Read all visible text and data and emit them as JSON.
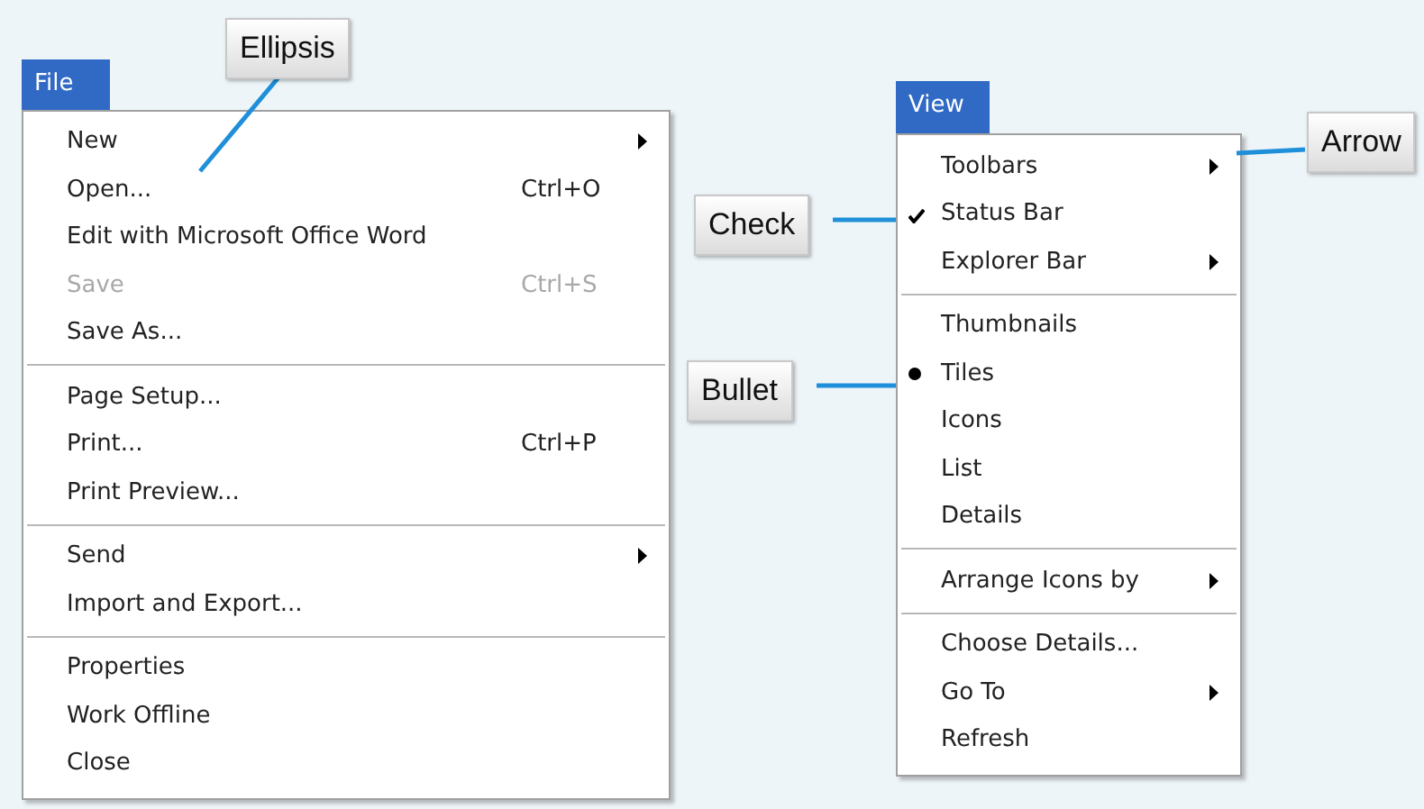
{
  "menus": [
    {
      "title": "File",
      "groups": [
        [
          {
            "label": "New",
            "submenu": true,
            "disabled": false
          },
          {
            "label": "Open...",
            "shortcut": "Ctrl+O",
            "submenu": false,
            "disabled": false
          },
          {
            "label": "Edit with Microsoft Office Word",
            "submenu": false,
            "disabled": false
          },
          {
            "label": "Save",
            "shortcut": "Ctrl+S",
            "submenu": false,
            "disabled": true
          },
          {
            "label": "Save As...",
            "submenu": false,
            "disabled": false
          }
        ],
        [
          {
            "label": "Page Setup...",
            "submenu": false,
            "disabled": false
          },
          {
            "label": "Print...",
            "shortcut": "Ctrl+P",
            "submenu": false,
            "disabled": false
          },
          {
            "label": "Print Preview...",
            "submenu": false,
            "disabled": false
          }
        ],
        [
          {
            "label": "Send",
            "submenu": true,
            "disabled": false
          },
          {
            "label": "Import and Export...",
            "submenu": false,
            "disabled": false
          }
        ],
        [
          {
            "label": "Properties",
            "submenu": false,
            "disabled": false
          },
          {
            "label": "Work Offline",
            "submenu": false,
            "disabled": false
          },
          {
            "label": "Close",
            "submenu": false,
            "disabled": false
          }
        ]
      ]
    },
    {
      "title": "View",
      "groups": [
        [
          {
            "label": "Toolbars",
            "submenu": true,
            "checked": false,
            "selected": false
          },
          {
            "label": "Status Bar",
            "submenu": false,
            "checked": true,
            "selected": false
          },
          {
            "label": "Explorer Bar",
            "submenu": true,
            "checked": false,
            "selected": false
          }
        ],
        [
          {
            "label": "Thumbnails",
            "submenu": false,
            "checked": false,
            "selected": false
          },
          {
            "label": "Tiles",
            "submenu": false,
            "checked": false,
            "selected": true
          },
          {
            "label": "Icons",
            "submenu": false,
            "checked": false,
            "selected": false
          },
          {
            "label": "List",
            "submenu": false,
            "checked": false,
            "selected": false
          },
          {
            "label": "Details",
            "submenu": false,
            "checked": false,
            "selected": false
          }
        ],
        [
          {
            "label": "Arrange Icons by",
            "submenu": true,
            "checked": false,
            "selected": false
          }
        ],
        [
          {
            "label": "Choose Details...",
            "submenu": false,
            "checked": false,
            "selected": false
          },
          {
            "label": "Go To",
            "submenu": true,
            "checked": false,
            "selected": false
          },
          {
            "label": "Refresh",
            "submenu": false,
            "checked": false,
            "selected": false
          }
        ]
      ]
    }
  ],
  "callouts": [
    {
      "label": "Ellipsis"
    },
    {
      "label": "Check"
    },
    {
      "label": "Bullet"
    },
    {
      "label": "Arrow"
    }
  ]
}
